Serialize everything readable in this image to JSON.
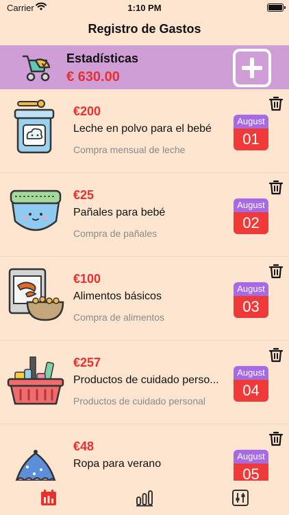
{
  "status_bar": {
    "carrier": "Carrier",
    "time": "1:10 PM"
  },
  "nav": {
    "title": "Registro de Gastos"
  },
  "stats": {
    "title": "Estadísticas",
    "total": "€ 630.00",
    "add_icon": "plus-square-icon",
    "color": "#cf9ed6"
  },
  "colors": {
    "background": "#fde5cf",
    "amount_red": "#e8302f",
    "month_purple": "#a66ae6",
    "day_red": "#f03a3a"
  },
  "expenses": [
    {
      "amount": "€200",
      "title": "Leche en polvo para el bebé",
      "note": "Compra mensual de leche",
      "month": "August",
      "day": "01",
      "icon": "milk-powder-icon"
    },
    {
      "amount": "€25",
      "title": "Pañales para bebé",
      "note": "Compra de pañales",
      "month": "August",
      "day": "02",
      "icon": "diaper-icon"
    },
    {
      "amount": "€100",
      "title": "Alimentos básicos",
      "note": "Compra de alimentos",
      "month": "August",
      "day": "03",
      "icon": "food-icon"
    },
    {
      "amount": "€257",
      "title": "Productos de cuidado perso...",
      "note": "Productos de cuidado personal",
      "month": "August",
      "day": "04",
      "icon": "shopping-basket-icon"
    },
    {
      "amount": "€48",
      "title": "Ropa para verano",
      "note": "",
      "month": "August",
      "day": "05",
      "icon": "baby-clothes-icon"
    }
  ],
  "tabs": [
    {
      "name": "calendar-icon",
      "active": true
    },
    {
      "name": "bar-chart-icon",
      "active": false
    },
    {
      "name": "sliders-icon",
      "active": false
    }
  ]
}
